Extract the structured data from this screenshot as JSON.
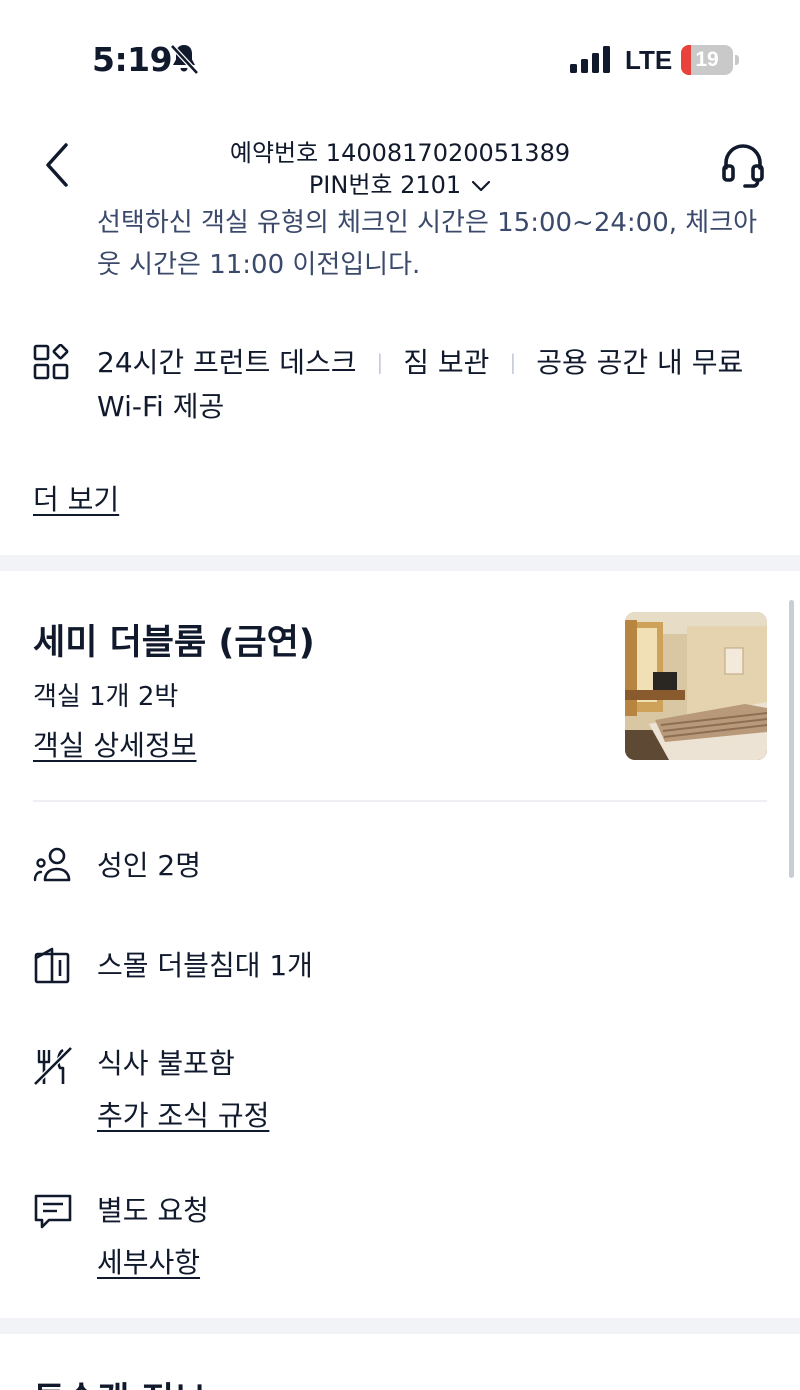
{
  "status_bar": {
    "time": "5:19",
    "network": "LTE",
    "battery": "19",
    "battery_level_percent": 19
  },
  "header": {
    "booking_number": "예약번호 1400817020051389",
    "pin": "PIN번호 2101"
  },
  "checkin_note": "선택하신 객실 유형의 체크인 시간은 15:00~24:00, 체크아웃 시간은 11:00 이전입니다.",
  "amenities": {
    "items": [
      "24시간 프런트 데스크",
      "짐 보관",
      "공용 공간 내 무료 Wi-Fi 제공"
    ],
    "more_label": "더 보기"
  },
  "room": {
    "title": "세미 더블룸 (금연)",
    "count": "객실 1개 2박",
    "detail_link": "객실 상세정보"
  },
  "details": {
    "guests": "성인 2명",
    "bed": "스몰 더블침대 1개",
    "meal": "식사 불포함",
    "meal_link": "추가 조식 규정",
    "request": "별도 요청",
    "request_link": "세부사항"
  },
  "next_section_title": "투숙객 정보",
  "icons": {
    "back": "back-icon",
    "support": "headset-icon",
    "amenity": "amenities-icon",
    "guests": "guests-icon",
    "bed": "bed-icon",
    "meal": "meal-icon",
    "request": "message-icon"
  },
  "colors": {
    "text": "#111a2c",
    "note_text": "#3b4a6b",
    "battery_low": "#e8423b",
    "band": "#f1f3f6"
  }
}
